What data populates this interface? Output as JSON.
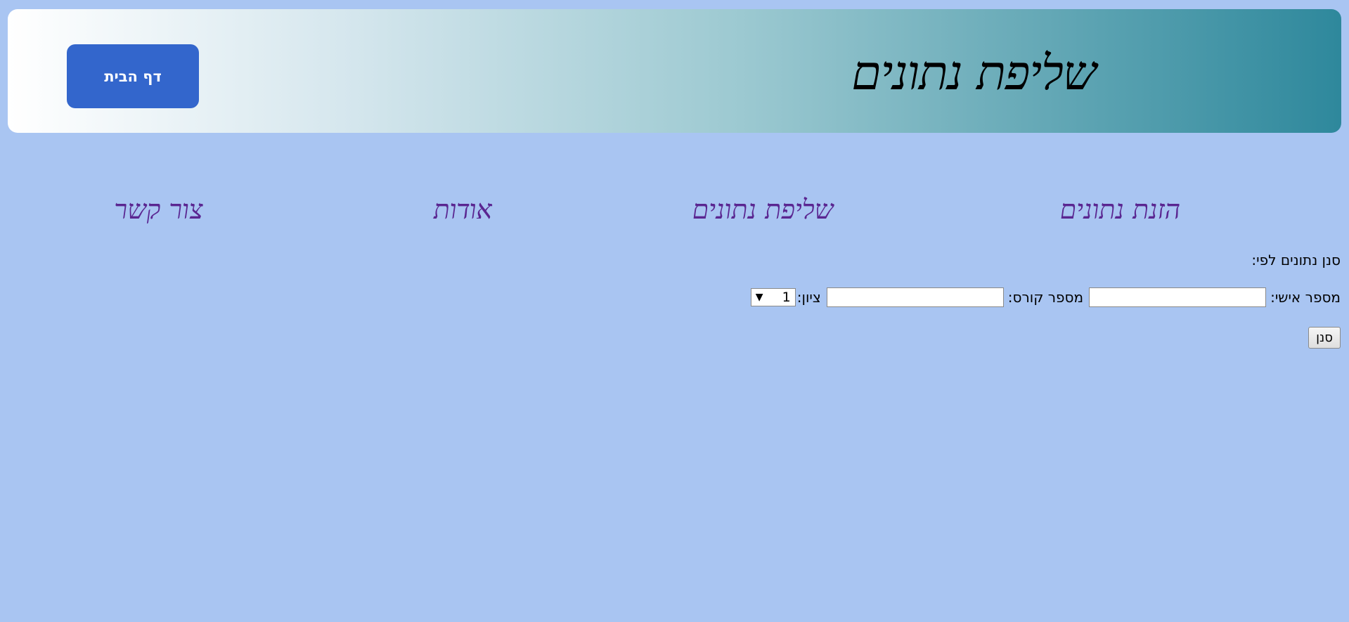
{
  "header": {
    "title": "שליפת נתונים",
    "home_button": "דף הבית"
  },
  "nav": {
    "items": [
      {
        "label": "הזנת נתונים"
      },
      {
        "label": "שליפת נתונים"
      },
      {
        "label": "אודות"
      },
      {
        "label": "צור קשר"
      }
    ]
  },
  "filter": {
    "heading": "סנן נתונים לפי:",
    "personal_id_label": "מספר אישי:",
    "personal_id_value": "",
    "course_label": "מספר קורס:",
    "course_value": "",
    "grade_label": "ציון:",
    "grade_selected": "1",
    "submit_label": "סנן"
  },
  "colors": {
    "page_background": "#a9c5f2",
    "header_gradient_start": "#2e889c",
    "header_gradient_end": "#ffffff",
    "home_button": "#3366cc",
    "nav_link": "#5a2691"
  }
}
